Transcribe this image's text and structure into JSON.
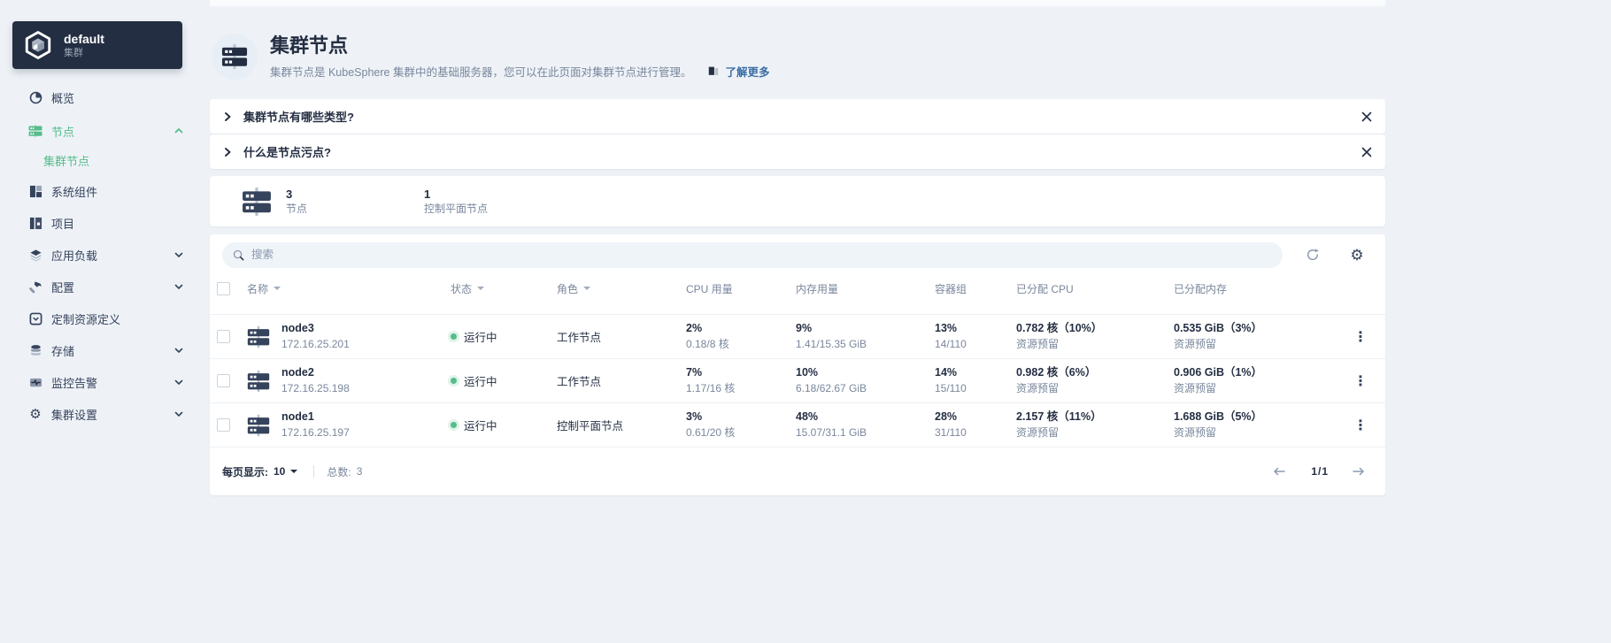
{
  "cluster": {
    "name": "default",
    "type": "集群"
  },
  "sidebar": {
    "items": [
      {
        "label": "概览"
      },
      {
        "label": "节点"
      },
      {
        "label": "系统组件"
      },
      {
        "label": "项目"
      },
      {
        "label": "应用负载"
      },
      {
        "label": "配置"
      },
      {
        "label": "定制资源定义"
      },
      {
        "label": "存储"
      },
      {
        "label": "监控告警"
      },
      {
        "label": "集群设置"
      }
    ],
    "nodes_children": [
      {
        "label": "集群节点"
      }
    ]
  },
  "header": {
    "title": "集群节点",
    "description": "集群节点是 KubeSphere 集群中的基础服务器，您可以在此页面对集群节点进行管理。",
    "learn_more": "了解更多"
  },
  "banners": [
    {
      "title": "集群节点有哪些类型?"
    },
    {
      "title": "什么是节点污点?"
    }
  ],
  "stats": {
    "nodes": {
      "value": "3",
      "label": "节点"
    },
    "control_plane": {
      "value": "1",
      "label": "控制平面节点"
    }
  },
  "toolbar": {
    "search_placeholder": "搜索"
  },
  "table": {
    "columns": [
      "名称",
      "状态",
      "角色",
      "CPU 用量",
      "内存用量",
      "容器组",
      "已分配 CPU",
      "已分配内存"
    ],
    "reserved_label": "资源预留",
    "rows": [
      {
        "name": "node3",
        "ip": "172.16.25.201",
        "status": "运行中",
        "role": "工作节点",
        "cpu_pct": "2%",
        "cpu_detail": "0.18/8 核",
        "mem_pct": "9%",
        "mem_detail": "1.41/15.35 GiB",
        "pods_pct": "13%",
        "pods_detail": "14/110",
        "alloc_cpu": "0.782 核（10%）",
        "alloc_mem": "0.535 GiB（3%）"
      },
      {
        "name": "node2",
        "ip": "172.16.25.198",
        "status": "运行中",
        "role": "工作节点",
        "cpu_pct": "7%",
        "cpu_detail": "1.17/16 核",
        "mem_pct": "10%",
        "mem_detail": "6.18/62.67 GiB",
        "pods_pct": "14%",
        "pods_detail": "15/110",
        "alloc_cpu": "0.982 核（6%）",
        "alloc_mem": "0.906 GiB（1%）"
      },
      {
        "name": "node1",
        "ip": "172.16.25.197",
        "status": "运行中",
        "role": "控制平面节点",
        "cpu_pct": "3%",
        "cpu_detail": "0.61/20 核",
        "mem_pct": "48%",
        "mem_detail": "15.07/31.1 GiB",
        "pods_pct": "28%",
        "pods_detail": "31/110",
        "alloc_cpu": "2.157 核（11%）",
        "alloc_mem": "1.688 GiB（5%）"
      }
    ]
  },
  "pagination": {
    "per_page_label": "每页显示:",
    "per_page": "10",
    "total_label": "总数:",
    "total": "3",
    "page": "1/1"
  }
}
